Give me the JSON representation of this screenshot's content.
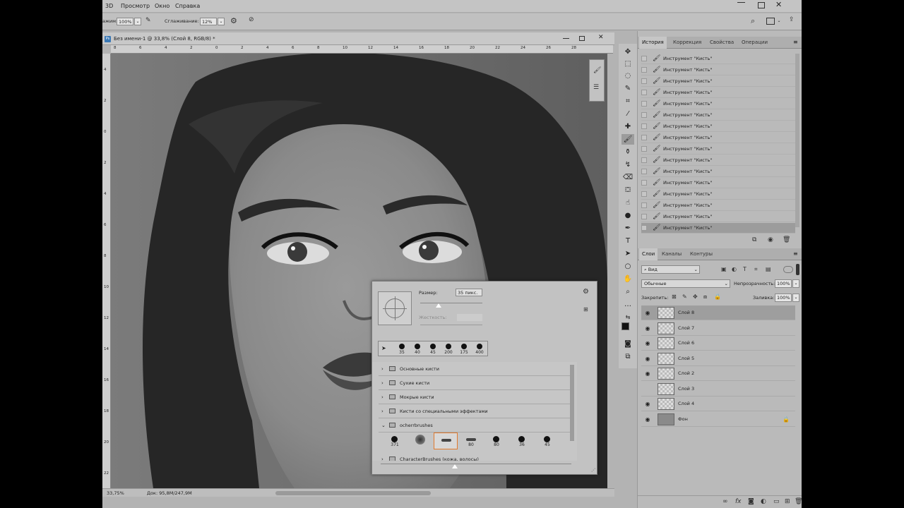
{
  "menubar": {
    "items": [
      "3D",
      "Просмотр",
      "Окно",
      "Справка"
    ]
  },
  "options_bar": {
    "opacity_label": "ажим:",
    "opacity_value": "100%",
    "smoothing_label": "Сглаживание:",
    "smoothing_value": "12%"
  },
  "document": {
    "tab_title": "Без имени-1 @ 33,8% (Слой 8, RGB/8) *",
    "ruler_top": [
      "8",
      "6",
      "4",
      "2",
      "0",
      "2",
      "4",
      "6",
      "8",
      "10",
      "12",
      "14",
      "16",
      "18",
      "20",
      "22",
      "24",
      "26",
      "28"
    ],
    "ruler_left": [
      "4",
      "2",
      "0",
      "2",
      "4",
      "6",
      "8",
      "10",
      "12",
      "14",
      "16",
      "18",
      "20",
      "22"
    ]
  },
  "status": {
    "zoom": "33,75%",
    "doc_info": "Док: 95,8M/247,9M"
  },
  "history_panel": {
    "tabs": [
      "История",
      "Коррекция",
      "Свойства",
      "Операции"
    ],
    "active_tab": 0,
    "items": [
      "Инструмент \"Кисть\"",
      "Инструмент \"Кисть\"",
      "Инструмент \"Кисть\"",
      "Инструмент \"Кисть\"",
      "Инструмент \"Кисть\"",
      "Инструмент \"Кисть\"",
      "Инструмент \"Кисть\"",
      "Инструмент \"Кисть\"",
      "Инструмент \"Кисть\"",
      "Инструмент \"Кисть\"",
      "Инструмент \"Кисть\"",
      "Инструмент \"Кисть\"",
      "Инструмент \"Кисть\"",
      "Инструмент \"Кисть\"",
      "Инструмент \"Кисть\"",
      "Инструмент \"Кисть\""
    ],
    "selected_index": 15
  },
  "layers_panel": {
    "tabs": [
      "Слои",
      "Каналы",
      "Контуры"
    ],
    "active_tab": 0,
    "filter_kind": "Вид",
    "blend_mode": "Обычные",
    "opacity_label": "Непрозрачность:",
    "opacity_value": "100%",
    "lock_label": "Закрепить:",
    "fill_label": "Заливка:",
    "fill_value": "100%",
    "layers": [
      {
        "name": "Слой 8",
        "visible": true,
        "selected": true
      },
      {
        "name": "Слой 7",
        "visible": true,
        "selected": false
      },
      {
        "name": "Слой 6",
        "visible": true,
        "selected": false
      },
      {
        "name": "Слой 5",
        "visible": true,
        "selected": false
      },
      {
        "name": "Слой 2",
        "visible": true,
        "selected": false
      },
      {
        "name": "Слой 3",
        "visible": false,
        "selected": false
      },
      {
        "name": "Слой 4",
        "visible": true,
        "selected": false
      },
      {
        "name": "Фон",
        "visible": true,
        "selected": false,
        "locked": true
      }
    ]
  },
  "brush_popup": {
    "size_label": "Размер:",
    "size_value": "35 пикс.",
    "hardness_label": "Жесткость:",
    "recent_sizes": [
      "35",
      "40",
      "45",
      "200",
      "175",
      "400"
    ],
    "groups": [
      "Основные кисти",
      "Сухие кисти",
      "Мокрые кисти",
      "Кисти со специальными эффектами",
      "ocherrbrushes",
      "CharacterBrushes (кожа, волосы)"
    ],
    "expanded_group": "ocherrbrushes",
    "group_presets": [
      "371",
      "",
      "",
      "80",
      "80",
      "36",
      "45"
    ],
    "selected_preset_index": 2
  }
}
